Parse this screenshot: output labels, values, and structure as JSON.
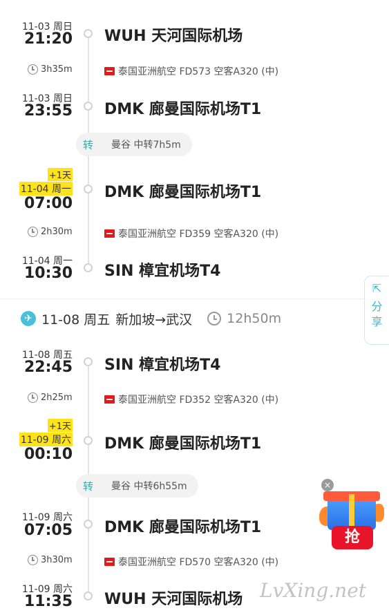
{
  "outbound": {
    "stops": [
      {
        "date": "11-03 周日",
        "time": "21:20",
        "airport": "WUH 天河国际机场",
        "highlight": false,
        "plus_day": ""
      },
      {
        "date": "11-03 周日",
        "time": "23:55",
        "airport": "DMK 廊曼国际机场T1",
        "highlight": false,
        "plus_day": ""
      },
      {
        "date": "11-04 周一",
        "time": "07:00",
        "airport": "DMK 廊曼国际机场T1",
        "highlight": true,
        "plus_day": "+1天"
      },
      {
        "date": "11-04 周一",
        "time": "10:30",
        "airport": "SIN 樟宜机场T4",
        "highlight": false,
        "plus_day": ""
      }
    ],
    "segments": [
      {
        "duration": "3h35m",
        "flight": "泰国亚洲航空 FD573 空客A320 (中)"
      },
      {
        "duration": "2h30m",
        "flight": "泰国亚洲航空 FD359 空客A320 (中)"
      }
    ],
    "transfer": {
      "icon": "转",
      "text": "曼谷 中转7h5m"
    }
  },
  "return_header": {
    "date": "11-08 周五",
    "route": "新加坡→武汉",
    "total": "12h50m"
  },
  "inbound": {
    "stops": [
      {
        "date": "11-08 周五",
        "time": "22:45",
        "airport": "SIN 樟宜机场T4",
        "highlight": false,
        "plus_day": ""
      },
      {
        "date": "11-09 周六",
        "time": "00:10",
        "airport": "DMK 廊曼国际机场T1",
        "highlight": true,
        "plus_day": "+1天"
      },
      {
        "date": "11-09 周六",
        "time": "07:05",
        "airport": "DMK 廊曼国际机场T1",
        "highlight": false,
        "plus_day": ""
      },
      {
        "date": "11-09 周六",
        "time": "11:35",
        "airport": "WUH 天河国际机场",
        "highlight": false,
        "plus_day": ""
      }
    ],
    "segments": [
      {
        "duration": "2h25m",
        "flight": "泰国亚洲航空 FD352 空客A320 (中)"
      },
      {
        "duration": "3h30m",
        "flight": "泰国亚洲航空 FD570 空客A320 (中)"
      }
    ],
    "transfer": {
      "icon": "转",
      "text": "曼谷 中转6h55m"
    }
  },
  "share": {
    "icon": "share-icon",
    "label": "分享"
  },
  "promo": {
    "button": "抢",
    "close": "×"
  },
  "watermark": "LvXing.net",
  "colors": {
    "accent": "#49c0d8",
    "transfer": "#2bb3a0",
    "highlight": "#ffe31a",
    "promo_red": "#e8142a"
  }
}
